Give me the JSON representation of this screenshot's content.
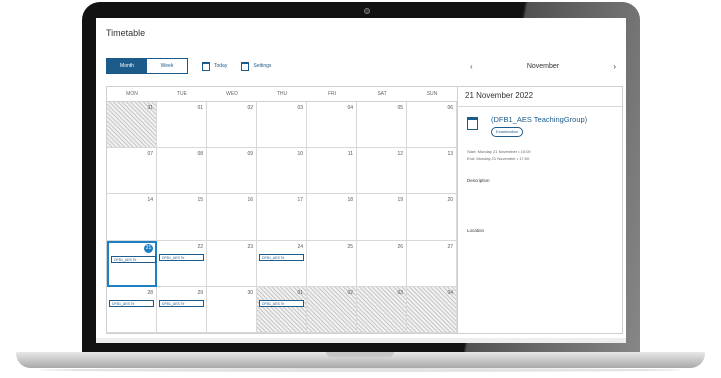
{
  "app": {
    "title": "Timetable"
  },
  "toolbar": {
    "month_label": "Month",
    "week_label": "Week",
    "today_label": "Today",
    "settings_label": "Settings"
  },
  "nav": {
    "month": "November",
    "prev": "‹",
    "next": "›"
  },
  "calendar": {
    "weekdays": [
      "MON",
      "TUE",
      "WED",
      "THU",
      "FRI",
      "SAT",
      "SUN"
    ],
    "weeks": [
      [
        "31",
        "01",
        "02",
        "03",
        "04",
        "05",
        "06"
      ],
      [
        "07",
        "08",
        "09",
        "10",
        "11",
        "12",
        "13"
      ],
      [
        "14",
        "15",
        "16",
        "17",
        "18",
        "19",
        "20"
      ],
      [
        "21",
        "22",
        "23",
        "24",
        "25",
        "26",
        "27"
      ],
      [
        "28",
        "29",
        "30",
        "01",
        "02",
        "03",
        "04"
      ]
    ],
    "event_label": "DFB1_AES Te"
  },
  "detail": {
    "date": "21 November 2022",
    "event_title": "(DFB1_AES TeachingGroup)",
    "badge": "Examination",
    "start": "Start: Monday 21 November • 15:00",
    "end": "End: Monday 21 November • 17:00",
    "description_label": "Description",
    "location_label": "Location"
  },
  "colors": {
    "accent": "#1d5b8a",
    "today": "#1d7fc4"
  }
}
